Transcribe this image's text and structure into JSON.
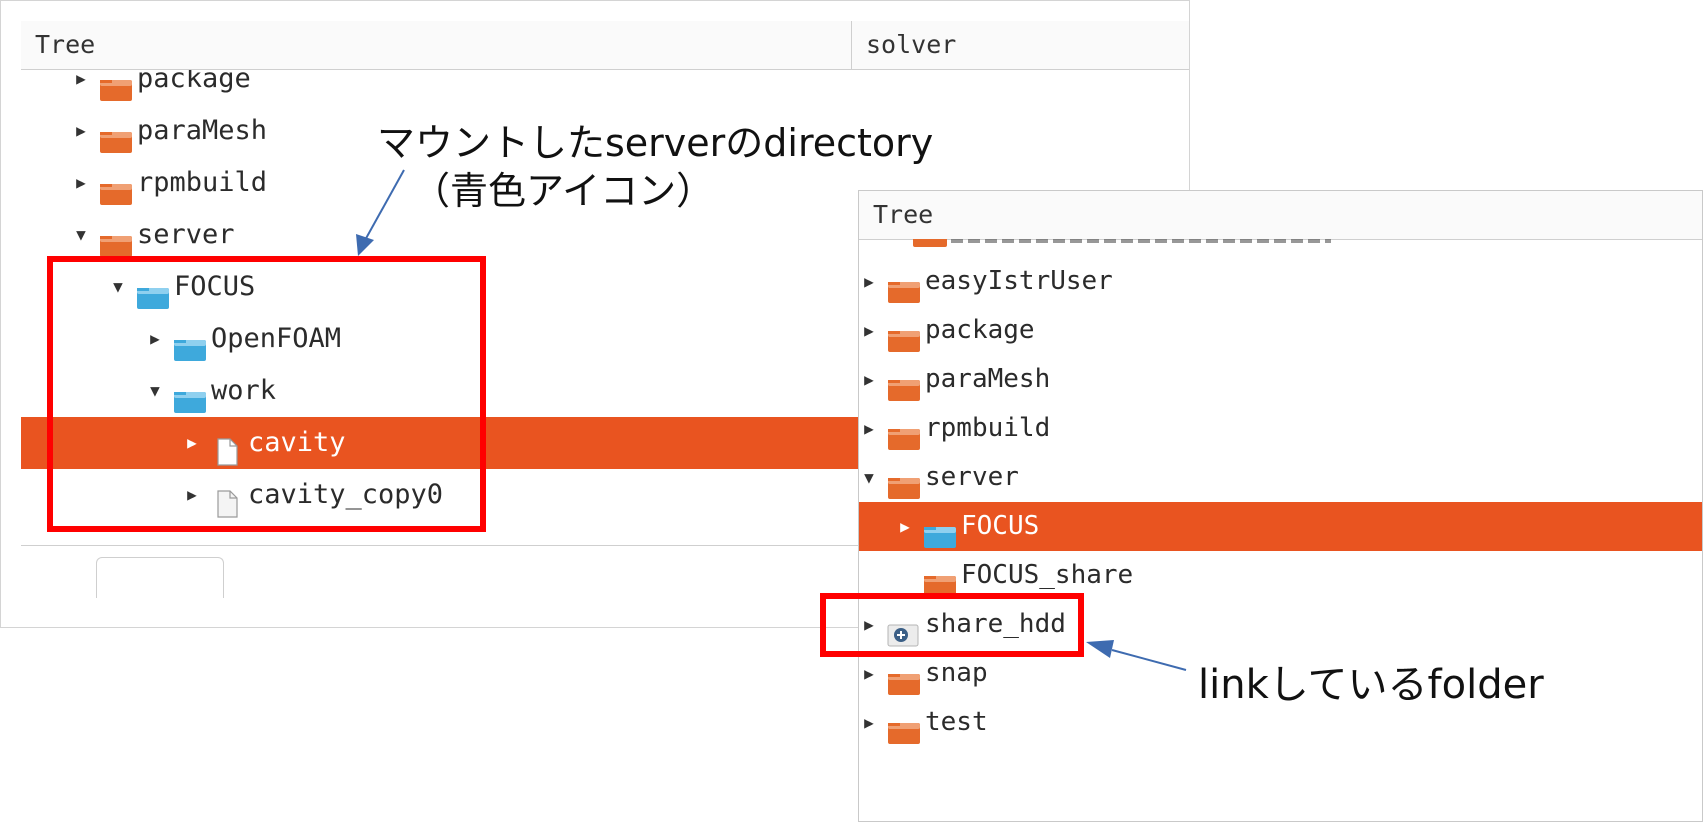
{
  "left_panel": {
    "columns": [
      "Tree",
      "solver"
    ],
    "rows": [
      {
        "label": "package",
        "icon": "folder-orange-icon",
        "state": "collapsed",
        "depth": 0
      },
      {
        "label": "paraMesh",
        "icon": "folder-orange-icon",
        "state": "collapsed",
        "depth": 0
      },
      {
        "label": "rpmbuild",
        "icon": "folder-orange-icon",
        "state": "collapsed",
        "depth": 0
      },
      {
        "label": "server",
        "icon": "folder-orange-icon",
        "state": "expanded",
        "depth": 0
      },
      {
        "label": "FOCUS",
        "icon": "folder-blue-icon",
        "state": "expanded",
        "depth": 1
      },
      {
        "label": "OpenFOAM",
        "icon": "folder-blue-icon",
        "state": "collapsed",
        "depth": 2
      },
      {
        "label": "work",
        "icon": "folder-blue-icon",
        "state": "expanded",
        "depth": 2
      },
      {
        "label": "cavity",
        "icon": "file-icon",
        "state": "collapsed",
        "depth": 3,
        "selected": true
      },
      {
        "label": "cavity_copy0",
        "icon": "file-icon",
        "state": "collapsed",
        "depth": 3
      }
    ]
  },
  "right_panel": {
    "columns": [
      "Tree"
    ],
    "rows": [
      {
        "label": "easyIstrUser",
        "icon": "folder-orange-icon",
        "state": "collapsed",
        "depth": 0
      },
      {
        "label": "package",
        "icon": "folder-orange-icon",
        "state": "collapsed",
        "depth": 0
      },
      {
        "label": "paraMesh",
        "icon": "folder-orange-icon",
        "state": "collapsed",
        "depth": 0
      },
      {
        "label": "rpmbuild",
        "icon": "folder-orange-icon",
        "state": "collapsed",
        "depth": 0
      },
      {
        "label": "server",
        "icon": "folder-orange-icon",
        "state": "expanded",
        "depth": 0
      },
      {
        "label": "FOCUS",
        "icon": "folder-blue-icon",
        "state": "collapsed",
        "depth": 1,
        "selected": true
      },
      {
        "label": "FOCUS_share",
        "icon": "folder-orange-icon",
        "state": "none",
        "depth": 1
      },
      {
        "label": "share_hdd",
        "icon": "link-folder-icon",
        "state": "collapsed",
        "depth": 0
      },
      {
        "label": "snap",
        "icon": "folder-orange-icon",
        "state": "collapsed",
        "depth": 0
      },
      {
        "label": "test",
        "icon": "folder-orange-icon",
        "state": "collapsed",
        "depth": 0
      }
    ]
  },
  "annotations": {
    "mount_line1": "マウントしたserverのdirectory",
    "mount_line2": "（青色アイコン）",
    "link_label": "linkしているfolder"
  },
  "colors": {
    "selection": "#e95420",
    "highlight_box": "#ff0000",
    "arrow": "#3e6bb0",
    "folder_orange": "#e56a2b",
    "folder_blue": "#3ea9dc"
  }
}
